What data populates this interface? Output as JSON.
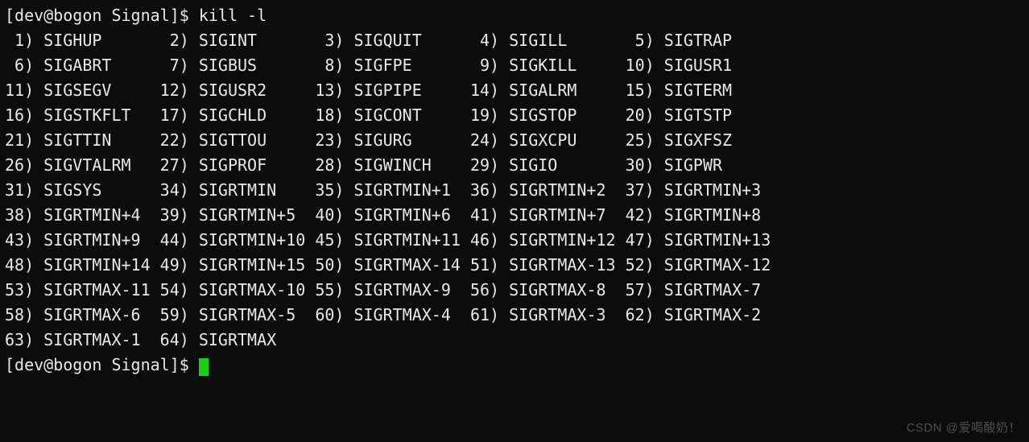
{
  "prompt_user": "dev",
  "prompt_host": "bogon",
  "prompt_dir": "Signal",
  "command": "kill -l",
  "watermark": "CSDN @爱喝酸奶！",
  "signals": [
    {
      "n": 1,
      "name": "SIGHUP"
    },
    {
      "n": 2,
      "name": "SIGINT"
    },
    {
      "n": 3,
      "name": "SIGQUIT"
    },
    {
      "n": 4,
      "name": "SIGILL"
    },
    {
      "n": 5,
      "name": "SIGTRAP"
    },
    {
      "n": 6,
      "name": "SIGABRT"
    },
    {
      "n": 7,
      "name": "SIGBUS"
    },
    {
      "n": 8,
      "name": "SIGFPE"
    },
    {
      "n": 9,
      "name": "SIGKILL"
    },
    {
      "n": 10,
      "name": "SIGUSR1"
    },
    {
      "n": 11,
      "name": "SIGSEGV"
    },
    {
      "n": 12,
      "name": "SIGUSR2"
    },
    {
      "n": 13,
      "name": "SIGPIPE"
    },
    {
      "n": 14,
      "name": "SIGALRM"
    },
    {
      "n": 15,
      "name": "SIGTERM"
    },
    {
      "n": 16,
      "name": "SIGSTKFLT"
    },
    {
      "n": 17,
      "name": "SIGCHLD"
    },
    {
      "n": 18,
      "name": "SIGCONT"
    },
    {
      "n": 19,
      "name": "SIGSTOP"
    },
    {
      "n": 20,
      "name": "SIGTSTP"
    },
    {
      "n": 21,
      "name": "SIGTTIN"
    },
    {
      "n": 22,
      "name": "SIGTTOU"
    },
    {
      "n": 23,
      "name": "SIGURG"
    },
    {
      "n": 24,
      "name": "SIGXCPU"
    },
    {
      "n": 25,
      "name": "SIGXFSZ"
    },
    {
      "n": 26,
      "name": "SIGVTALRM"
    },
    {
      "n": 27,
      "name": "SIGPROF"
    },
    {
      "n": 28,
      "name": "SIGWINCH"
    },
    {
      "n": 29,
      "name": "SIGIO"
    },
    {
      "n": 30,
      "name": "SIGPWR"
    },
    {
      "n": 31,
      "name": "SIGSYS"
    },
    {
      "n": 34,
      "name": "SIGRTMIN"
    },
    {
      "n": 35,
      "name": "SIGRTMIN+1"
    },
    {
      "n": 36,
      "name": "SIGRTMIN+2"
    },
    {
      "n": 37,
      "name": "SIGRTMIN+3"
    },
    {
      "n": 38,
      "name": "SIGRTMIN+4"
    },
    {
      "n": 39,
      "name": "SIGRTMIN+5"
    },
    {
      "n": 40,
      "name": "SIGRTMIN+6"
    },
    {
      "n": 41,
      "name": "SIGRTMIN+7"
    },
    {
      "n": 42,
      "name": "SIGRTMIN+8"
    },
    {
      "n": 43,
      "name": "SIGRTMIN+9"
    },
    {
      "n": 44,
      "name": "SIGRTMIN+10"
    },
    {
      "n": 45,
      "name": "SIGRTMIN+11"
    },
    {
      "n": 46,
      "name": "SIGRTMIN+12"
    },
    {
      "n": 47,
      "name": "SIGRTMIN+13"
    },
    {
      "n": 48,
      "name": "SIGRTMIN+14"
    },
    {
      "n": 49,
      "name": "SIGRTMIN+15"
    },
    {
      "n": 50,
      "name": "SIGRTMAX-14"
    },
    {
      "n": 51,
      "name": "SIGRTMAX-13"
    },
    {
      "n": 52,
      "name": "SIGRTMAX-12"
    },
    {
      "n": 53,
      "name": "SIGRTMAX-11"
    },
    {
      "n": 54,
      "name": "SIGRTMAX-10"
    },
    {
      "n": 55,
      "name": "SIGRTMAX-9"
    },
    {
      "n": 56,
      "name": "SIGRTMAX-8"
    },
    {
      "n": 57,
      "name": "SIGRTMAX-7"
    },
    {
      "n": 58,
      "name": "SIGRTMAX-6"
    },
    {
      "n": 59,
      "name": "SIGRTMAX-5"
    },
    {
      "n": 60,
      "name": "SIGRTMAX-4"
    },
    {
      "n": 61,
      "name": "SIGRTMAX-3"
    },
    {
      "n": 62,
      "name": "SIGRTMAX-2"
    },
    {
      "n": 63,
      "name": "SIGRTMAX-1"
    },
    {
      "n": 64,
      "name": "SIGRTMAX"
    }
  ]
}
